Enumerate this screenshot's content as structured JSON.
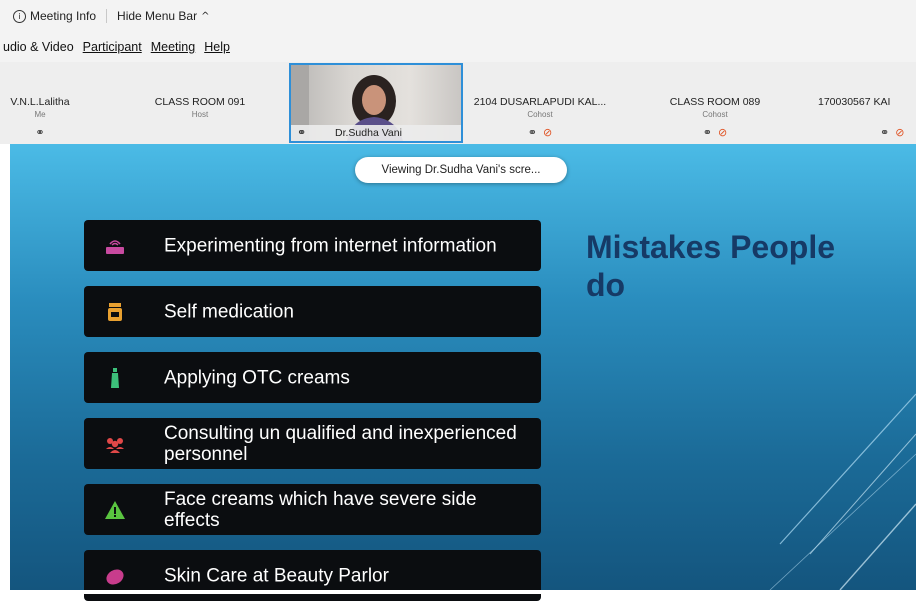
{
  "toolbar": {
    "meeting_info": "Meeting Info",
    "hide_menu_bar": "Hide Menu Bar"
  },
  "menu": {
    "items": [
      "udio & Video",
      "Participant",
      "Meeting",
      "Help"
    ]
  },
  "participants": [
    {
      "name": "V.N.L.Lalitha",
      "role": "Me"
    },
    {
      "name": "CLASS ROOM 091",
      "role": "Host"
    },
    {
      "name": "Dr.Sudha Vani",
      "role": ""
    },
    {
      "name": "2104 DUSARLAPUDI KAL...",
      "role": "Cohost"
    },
    {
      "name": "CLASS ROOM 089",
      "role": "Cohost"
    },
    {
      "name": "170030567 KAI",
      "role": ""
    }
  ],
  "sharing_toast": "Viewing Dr.Sudha Vani's scre...",
  "slide": {
    "heading_line1": "Mistakes People",
    "heading_line2": "do",
    "items": [
      "Experimenting from internet information",
      "Self medication",
      "Applying OTC creams",
      "Consulting un qualified and inexperienced personnel",
      "Face creams which have severe side effects",
      "Skin Care at Beauty Parlor"
    ]
  },
  "colors": {
    "accent_border": "#2e8fd8",
    "heading": "#163a66",
    "mic_muted": "#e05020"
  }
}
